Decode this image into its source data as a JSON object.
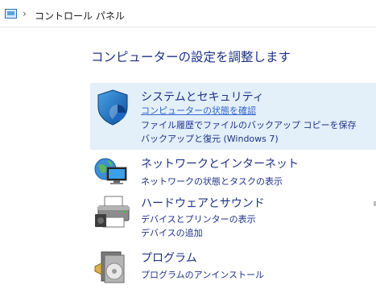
{
  "address_bar": {
    "icon": "control-panel-icon",
    "separator": "›",
    "breadcrumb": "コントロール パネル"
  },
  "heading": "コンピューターの設定を調整します",
  "categories": [
    {
      "icon": "shield-icon",
      "title": "システムとセキュリティ",
      "links": [
        "コンピューターの状態を確認",
        "ファイル履歴でファイルのバックアップ コピーを保存",
        "バックアップと復元 (Windows 7)"
      ]
    },
    {
      "icon": "network-globe-icon",
      "title": "ネットワークとインターネット",
      "links": [
        "ネットワークの状態とタスクの表示"
      ]
    },
    {
      "icon": "printer-icon",
      "title": "ハードウェアとサウンド",
      "links": [
        "デバイスとプリンターの表示",
        "デバイスの追加"
      ]
    },
    {
      "icon": "programs-icon",
      "title": "プログラム",
      "links": [
        "プログラムのアンインストール"
      ]
    }
  ],
  "colors": {
    "link": "#1e3287",
    "selected_background": "#e3eff9",
    "hover_link": "#3366cc"
  }
}
